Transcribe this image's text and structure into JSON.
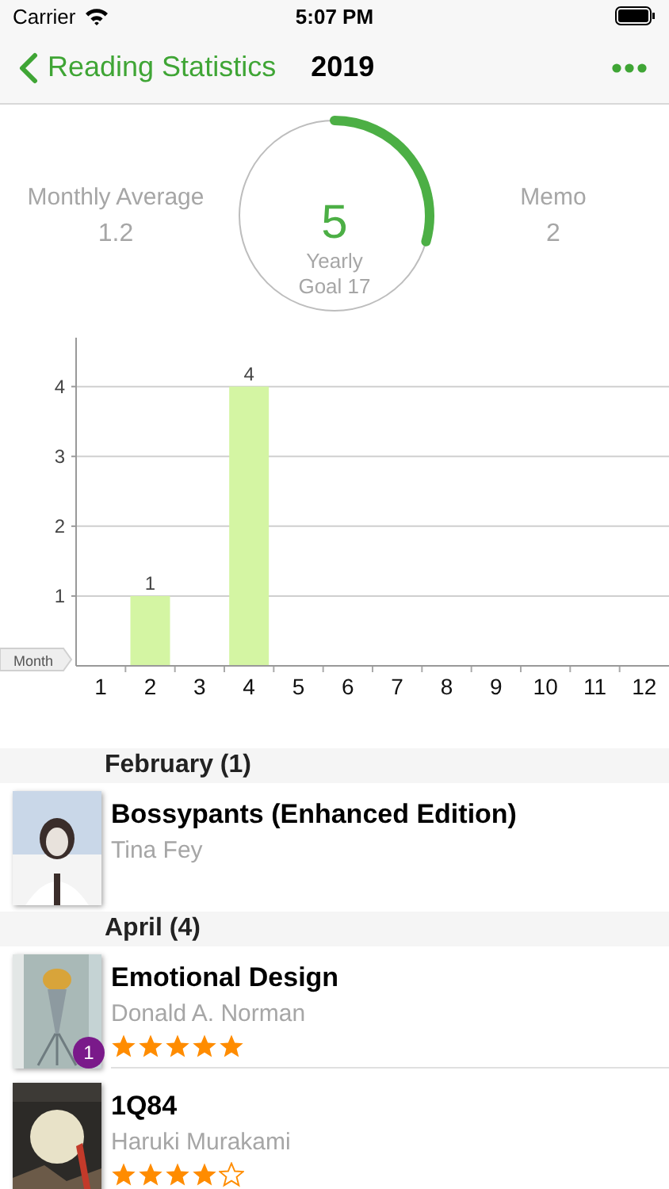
{
  "status_bar": {
    "carrier": "Carrier",
    "time": "5:07 PM"
  },
  "nav": {
    "back": "Reading Statistics",
    "title": "2019"
  },
  "stats": {
    "left": {
      "label": "Monthly Average",
      "value": "1.2"
    },
    "goal": {
      "count": "5",
      "caption_1": "Yearly",
      "caption_2": "Goal 17"
    },
    "right": {
      "label": "Memo",
      "value": "2"
    }
  },
  "chart_data": {
    "type": "bar",
    "xlabel": "Month",
    "categories": [
      "1",
      "2",
      "3",
      "4",
      "5",
      "6",
      "7",
      "8",
      "9",
      "10",
      "11",
      "12"
    ],
    "series": [
      {
        "color": "#d4f5a3",
        "values": [
          0,
          1,
          0,
          4,
          0,
          0,
          0,
          0,
          0,
          0,
          0,
          0
        ]
      }
    ],
    "ylim": [
      0,
      4.7
    ],
    "yticks": [
      1,
      2,
      3,
      4
    ],
    "grid": true,
    "value_labels": [
      null,
      "1",
      null,
      "4",
      null,
      null,
      null,
      null,
      null,
      null,
      null,
      null
    ]
  },
  "sections": [
    {
      "title": "February (1)",
      "books": [
        {
          "title": "Bossypants (Enhanced Edition)",
          "author": "Tina Fey"
        }
      ]
    },
    {
      "title": "April (4)",
      "books": [
        {
          "title": "Emotional Design",
          "author": "Donald A. Norman",
          "stars": 5,
          "badge": "1"
        },
        {
          "title": "1Q84",
          "author": "Haruki Murakami",
          "stars": 4
        }
      ]
    }
  ]
}
